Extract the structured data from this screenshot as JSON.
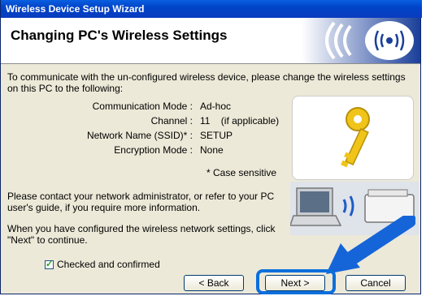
{
  "window": {
    "title": "Wireless Device Setup Wizard"
  },
  "header": {
    "title": "Changing PC's Wireless Settings"
  },
  "intro": "To communicate with the un-configured wireless device, please change the wireless settings on this PC to the following:",
  "settings": [
    {
      "label": "Communication Mode :",
      "value": "Ad-hoc"
    },
    {
      "label": "Channel :",
      "value": "11    (if applicable)"
    },
    {
      "label": "Network Name (SSID)* :",
      "value": "SETUP"
    },
    {
      "label": "Encryption Mode :",
      "value": "None"
    }
  ],
  "case_note": "* Case sensitive",
  "contact_text": "Please contact your network administrator, or refer to your PC user's guide, if you require more information.",
  "configured_text": "When you have configured the wireless network settings, click \"Next\" to continue.",
  "checkbox": {
    "label": "Checked and confirmed",
    "checked": true
  },
  "buttons": {
    "back": "< Back",
    "next": "Next >",
    "cancel": "Cancel"
  },
  "colors": {
    "titlebar": "#0044c8",
    "highlight": "#0b6fdc",
    "dialog_bg": "#ece9d8"
  }
}
